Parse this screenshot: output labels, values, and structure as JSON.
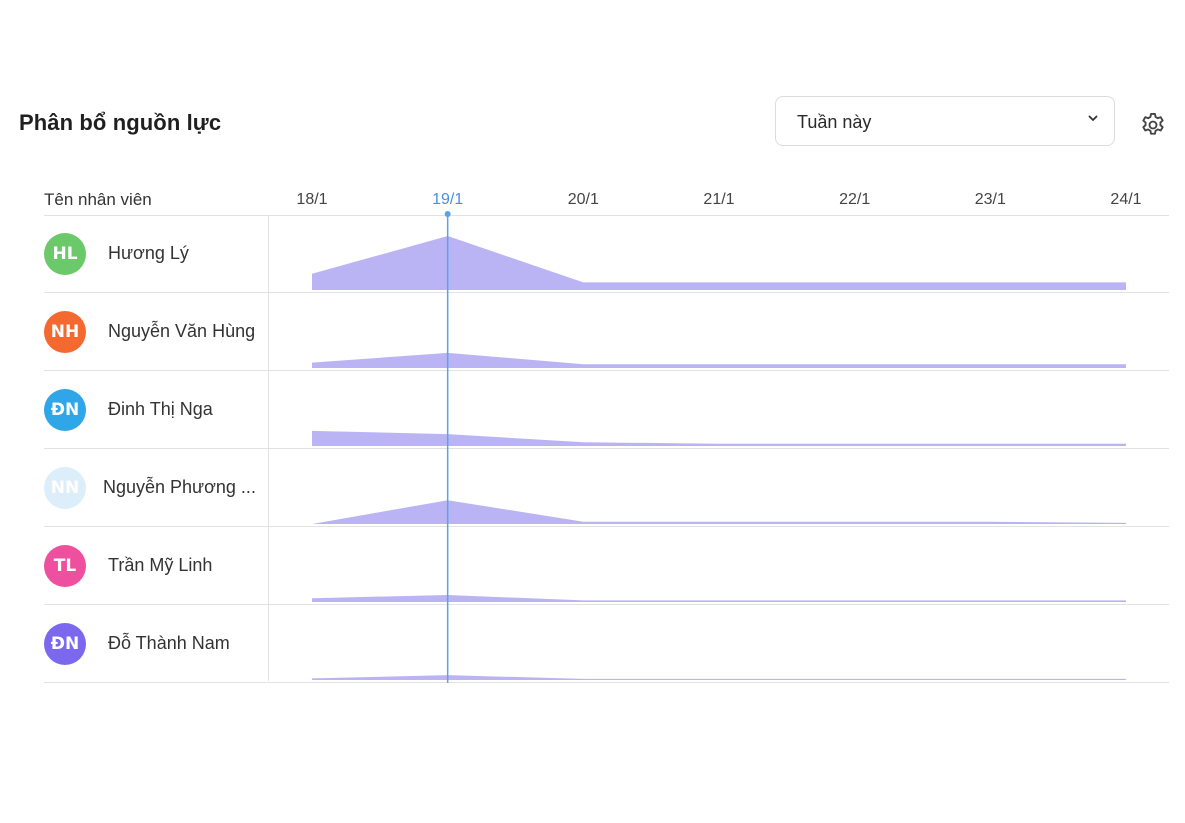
{
  "header": {
    "title": "Phân bổ nguồn lực",
    "period_select": {
      "value": "Tuần này"
    }
  },
  "grid": {
    "name_column_header": "Tên nhân viên",
    "dates": [
      "18/1",
      "19/1",
      "20/1",
      "21/1",
      "22/1",
      "23/1",
      "24/1"
    ],
    "current_date_index": 1
  },
  "employees": [
    {
      "initials": "HL",
      "name": "Hương Lý",
      "avatar_color": "#6cc96a"
    },
    {
      "initials": "NH",
      "name": "Nguyễn Văn Hùng",
      "avatar_color": "#f4692f"
    },
    {
      "initials": "ĐN",
      "name": "Đinh Thị Nga",
      "avatar_color": "#2ea6e8"
    },
    {
      "initials": "NN",
      "name": "Nguyễn Phương ...",
      "avatar_color": "#ddeefb"
    },
    {
      "initials": "TL",
      "name": "Trần Mỹ Linh",
      "avatar_color": "#ee4f9e"
    },
    {
      "initials": "ĐN",
      "name": "Đỗ Thành Nam",
      "avatar_color": "#7b68ee"
    }
  ],
  "colors": {
    "load_fill": "#bab4f5",
    "today_line": "#5aa2ea"
  },
  "chart_data": {
    "type": "area",
    "categories": [
      "18/1",
      "19/1",
      "20/1",
      "21/1",
      "22/1",
      "23/1",
      "24/1"
    ],
    "series": [
      {
        "name": "Hương Lý",
        "values": [
          0.3,
          1.0,
          0.14,
          0.14,
          0.14,
          0.14,
          0.14
        ]
      },
      {
        "name": "Nguyễn Văn Hùng",
        "values": [
          0.1,
          0.28,
          0.07,
          0.07,
          0.07,
          0.07,
          0.07
        ]
      },
      {
        "name": "Đinh Thị Nga",
        "values": [
          0.28,
          0.22,
          0.07,
          0.04,
          0.04,
          0.04,
          0.04
        ]
      },
      {
        "name": "Nguyễn Phương ...",
        "values": [
          0.0,
          0.44,
          0.04,
          0.04,
          0.04,
          0.04,
          0.02
        ]
      },
      {
        "name": "Trần Mỹ Linh",
        "values": [
          0.07,
          0.13,
          0.03,
          0.03,
          0.03,
          0.03,
          0.03
        ]
      },
      {
        "name": "Đỗ Thành Nam",
        "values": [
          0.03,
          0.09,
          0.02,
          0.02,
          0.02,
          0.02,
          0.02
        ]
      }
    ],
    "ylim": [
      0,
      1
    ]
  }
}
